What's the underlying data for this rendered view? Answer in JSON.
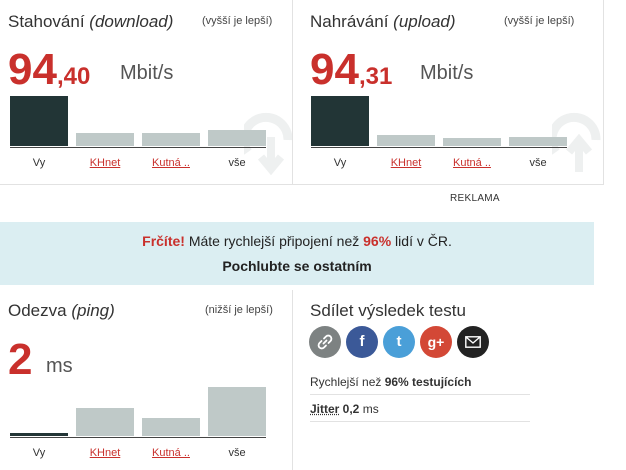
{
  "download": {
    "title": "Stahování",
    "title_italic": "(download)",
    "hint": "(vyšší je lepší)",
    "value_int": "94",
    "value_dec": ",40",
    "unit": "Mbit/s",
    "bar_labels": [
      "Vy",
      "KHnet",
      "Kutná ..",
      "vše"
    ]
  },
  "upload": {
    "title": "Nahrávání",
    "title_italic": "(upload)",
    "hint": "(vyšší je lepší)",
    "value_int": "94",
    "value_dec": ",31",
    "unit": "Mbit/s",
    "bar_labels": [
      "Vy",
      "KHnet",
      "Kutná ..",
      "vše"
    ]
  },
  "reklama": "REKLAMA",
  "banner": {
    "exclaim": "Frčíte!",
    "text_before": " Máte rychlejší připojení než ",
    "percent": "96%",
    "text_after": " lidí v ČR.",
    "cta": "Pochlubte se ostatním"
  },
  "ping": {
    "title": "Odezva",
    "title_italic": "(ping)",
    "hint": "(nižší je lepší)",
    "value": "2",
    "unit": "ms",
    "bar_labels": [
      "Vy",
      "KHnet",
      "Kutná ..",
      "vše"
    ]
  },
  "share": {
    "title": "Sdílet výsledek testu",
    "buttons": [
      {
        "name": "link",
        "glyph": "🔗",
        "color": "#7d8282"
      },
      {
        "name": "facebook",
        "glyph": "f",
        "color": "#3b5998"
      },
      {
        "name": "twitter",
        "glyph": "t",
        "color": "#4a9fd8"
      },
      {
        "name": "google-plus",
        "glyph": "g+",
        "color": "#d34836"
      },
      {
        "name": "email",
        "glyph": "✉",
        "color": "#222222"
      }
    ]
  },
  "stats": {
    "faster_label": "Rychlejší než ",
    "faster_value": "96% testujících",
    "jitter_label": "Jitter",
    "jitter_value": " 0,2",
    "jitter_unit": " ms"
  },
  "colors": {
    "accent": "#c9302c",
    "dark_bar": "#223536",
    "light_bar": "#bfc9c8",
    "banner_bg": "#dbeef2"
  }
}
